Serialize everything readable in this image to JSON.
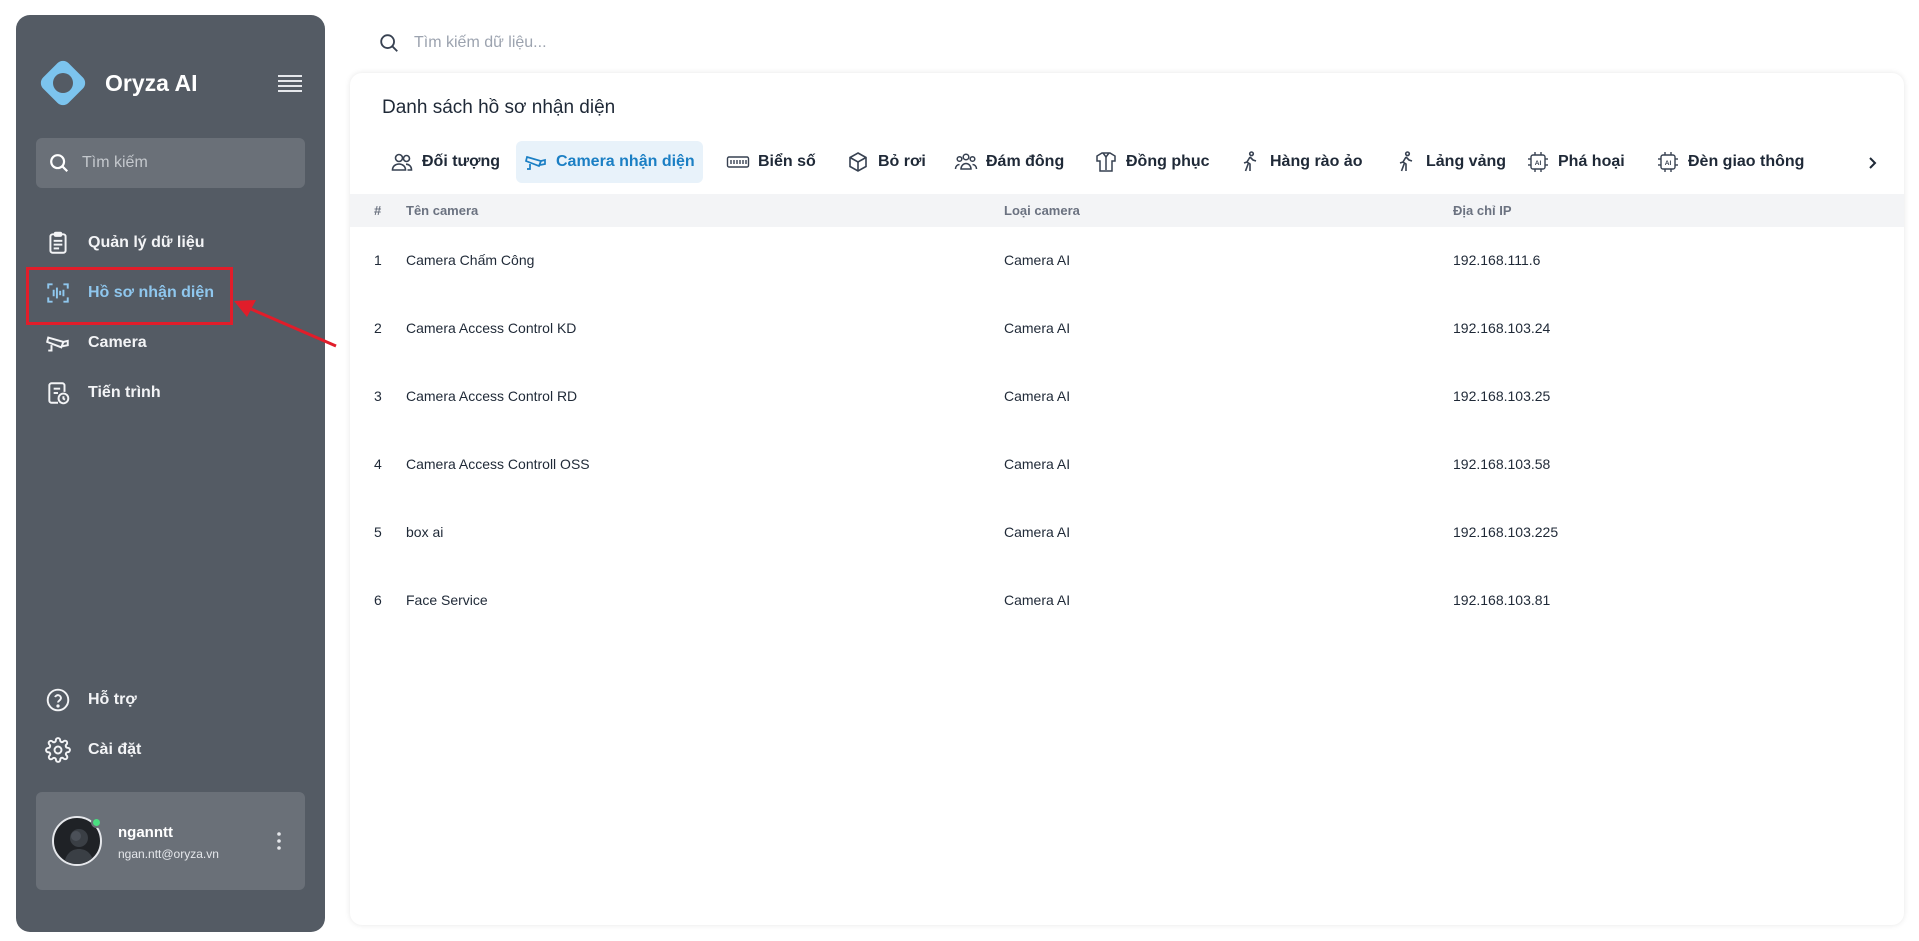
{
  "sidebar": {
    "brand": "Oryza AI",
    "search_placeholder": "Tìm kiếm",
    "nav": [
      {
        "label": "Quản lý dữ liệu",
        "icon": "clipboard-icon"
      },
      {
        "label": "Hồ sơ nhận diện",
        "icon": "face-scan-icon",
        "active": true
      },
      {
        "label": "Camera",
        "icon": "cctv-camera-icon"
      },
      {
        "label": "Tiến trình",
        "icon": "process-clock-icon"
      }
    ],
    "bottom": [
      {
        "label": "Hỗ trợ",
        "icon": "help-circle-icon"
      },
      {
        "label": "Cài đặt",
        "icon": "gear-icon"
      }
    ],
    "user": {
      "name": "nganntt",
      "email": "ngan.ntt@oryza.vn"
    }
  },
  "topbar": {
    "search_placeholder": "Tìm kiếm dữ liệu..."
  },
  "main": {
    "title": "Danh sách hồ sơ nhận diện",
    "tabs": [
      {
        "label": "Đối tượng",
        "icon": "users-icon"
      },
      {
        "label": "Camera nhận diện",
        "icon": "cctv-camera-icon",
        "active": true
      },
      {
        "label": "Biển số",
        "icon": "license-plate-icon"
      },
      {
        "label": "Bỏ rơi",
        "icon": "box-icon"
      },
      {
        "label": "Đám đông",
        "icon": "crowd-icon"
      },
      {
        "label": "Đồng phục",
        "icon": "uniform-shirt-icon"
      },
      {
        "label": "Hàng rào ảo",
        "icon": "walking-person-icon"
      },
      {
        "label": "Lảng vảng",
        "icon": "walking-person-icon"
      },
      {
        "label": "Phá hoại",
        "icon": "ai-chip-icon"
      },
      {
        "label": "Đèn giao thông",
        "icon": "ai-chip-icon"
      }
    ],
    "table": {
      "columns": [
        "#",
        "Tên camera",
        "Loại camera",
        "Địa chỉ IP"
      ],
      "rows": [
        {
          "idx": "1",
          "name": "Camera Chấm Công",
          "type": "Camera AI",
          "ip": "192.168.111.6"
        },
        {
          "idx": "2",
          "name": "Camera Access Control KD",
          "type": "Camera AI",
          "ip": "192.168.103.24"
        },
        {
          "idx": "3",
          "name": "Camera Access Control RD",
          "type": "Camera AI",
          "ip": "192.168.103.25"
        },
        {
          "idx": "4",
          "name": "Camera Access Controll OSS",
          "type": "Camera AI",
          "ip": "192.168.103.58"
        },
        {
          "idx": "5",
          "name": "box ai",
          "type": "Camera AI",
          "ip": "192.168.103.225"
        },
        {
          "idx": "6",
          "name": "Face Service",
          "type": "Camera AI",
          "ip": "192.168.103.81"
        }
      ]
    }
  },
  "colors": {
    "sidebar_bg": "#545b64",
    "accent": "#1b7fc4",
    "annotation": "#e11d2a"
  }
}
